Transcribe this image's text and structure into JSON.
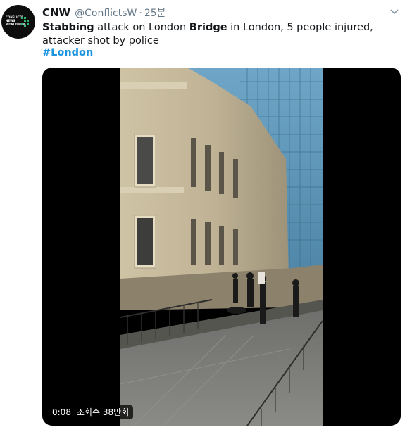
{
  "tweet": {
    "author_name": "CNW",
    "handle": "@ConflictsW",
    "separator": "·",
    "time": "25분",
    "text_parts": {
      "p1": "Stabbing",
      "p2": " attack on London ",
      "p3": "Bridge",
      "p4": " in London, 5 people injured, attacker shot by police"
    },
    "hashtag": "#London",
    "avatar_text": "CONFLICTS NEWS WORLDWIDE"
  },
  "video": {
    "duration": "0:08",
    "views": "조회수 38만회"
  },
  "colors": {
    "link": "#1b95e0",
    "secondary": "#657786",
    "avatar_accent": "#2bb673"
  },
  "icons": [
    "chevron-down-icon"
  ]
}
